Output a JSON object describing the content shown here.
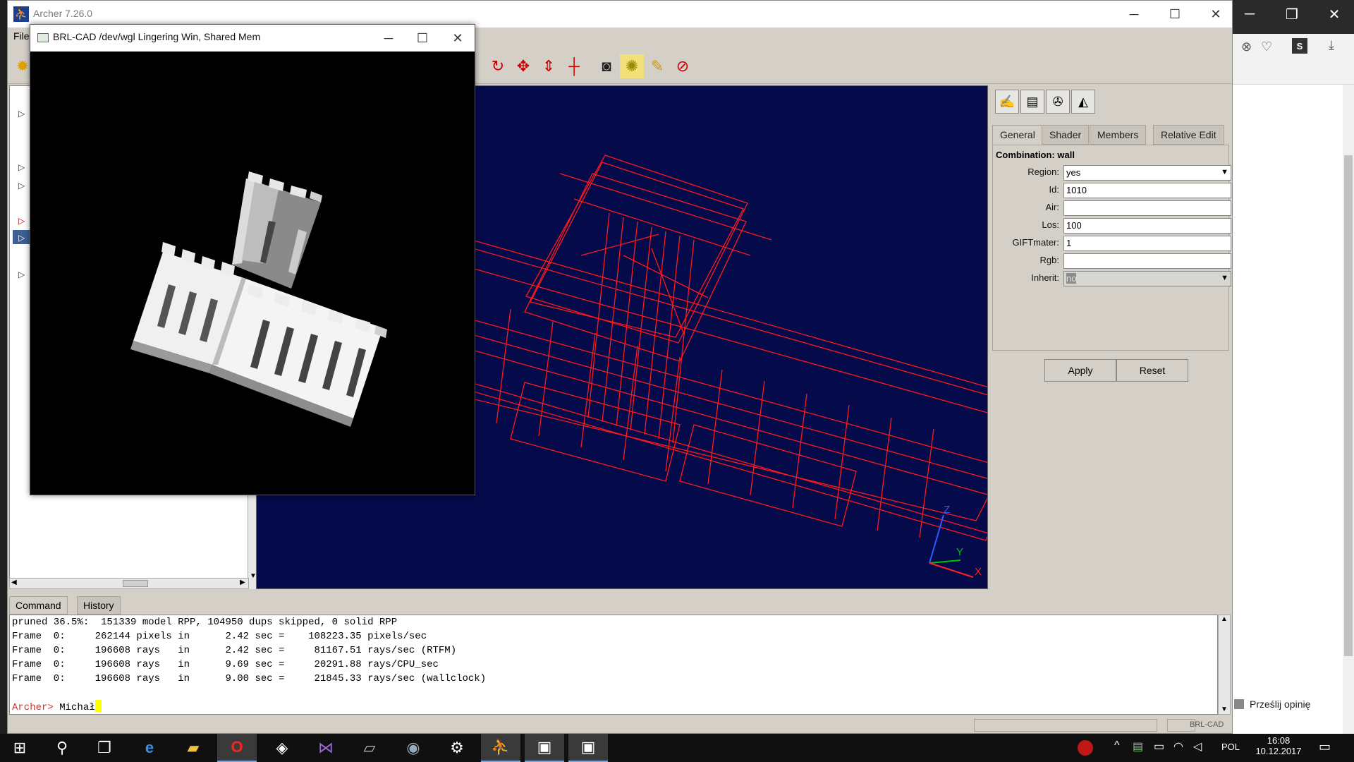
{
  "archer": {
    "title": "Archer 7.26.0",
    "icon": "archer-icon",
    "menu": {
      "file": "File"
    },
    "window_controls": {
      "minimize": "─",
      "maximize": "☐",
      "close": "✕"
    }
  },
  "brl_window": {
    "title": "BRL-CAD /dev/wgl Lingering Win, Shared Mem",
    "controls": {
      "minimize": "─",
      "maximize": "☐",
      "close": "✕"
    }
  },
  "toolbar": {
    "buttons": [
      "rotate-icon",
      "translate-icon",
      "scale-icon",
      "center-icon",
      "camera-icon",
      "raytrace-icon",
      "clear-icon",
      "reset-icon"
    ]
  },
  "edit_panel": {
    "tabs": [
      "General",
      "Shader",
      "Members",
      "Relative Edit"
    ],
    "active_tab": "General",
    "combination_label": "Combination: wall",
    "fields": {
      "region": {
        "label": "Region:",
        "value": "yes"
      },
      "id": {
        "label": "Id:",
        "value": "1010"
      },
      "air": {
        "label": "Air:",
        "value": ""
      },
      "los": {
        "label": "Los:",
        "value": "100"
      },
      "giftmater": {
        "label": "GIFTmater:",
        "value": "1"
      },
      "rgb": {
        "label": "Rgb:",
        "value": ""
      },
      "inherit": {
        "label": "Inherit:",
        "value": "no"
      }
    },
    "apply_label": "Apply",
    "reset_label": "Reset"
  },
  "command": {
    "tabs": [
      "Command",
      "History"
    ],
    "lines": [
      "pruned 36.5%:  151339 model RPP, 104950 dups skipped, 0 solid RPP",
      "Frame  0:     262144 pixels in      2.42 sec =    108223.35 pixels/sec",
      "Frame  0:     196608 rays   in      2.42 sec =     81167.51 rays/sec (RTFM)",
      "Frame  0:     196608 rays   in      9.69 sec =     20291.88 rays/CPU_sec",
      "Frame  0:     196608 rays   in      9.00 sec =     21845.33 rays/sec (wallclock)"
    ],
    "prompt": "Archer>",
    "input": "Michał"
  },
  "axes": {
    "x": "X",
    "y": "Y",
    "z": "Z"
  },
  "status": {
    "brl_cad": "BRL-CAD"
  },
  "browser": {
    "feedback": "Prześlij opinię"
  },
  "taskbar": {
    "language": "POL",
    "time": "16:08",
    "date": "10.12.2017"
  },
  "colors": {
    "viewport_bg": "#050a4a",
    "wireframe": "#ff1a1a",
    "prompt": "#d03030"
  }
}
